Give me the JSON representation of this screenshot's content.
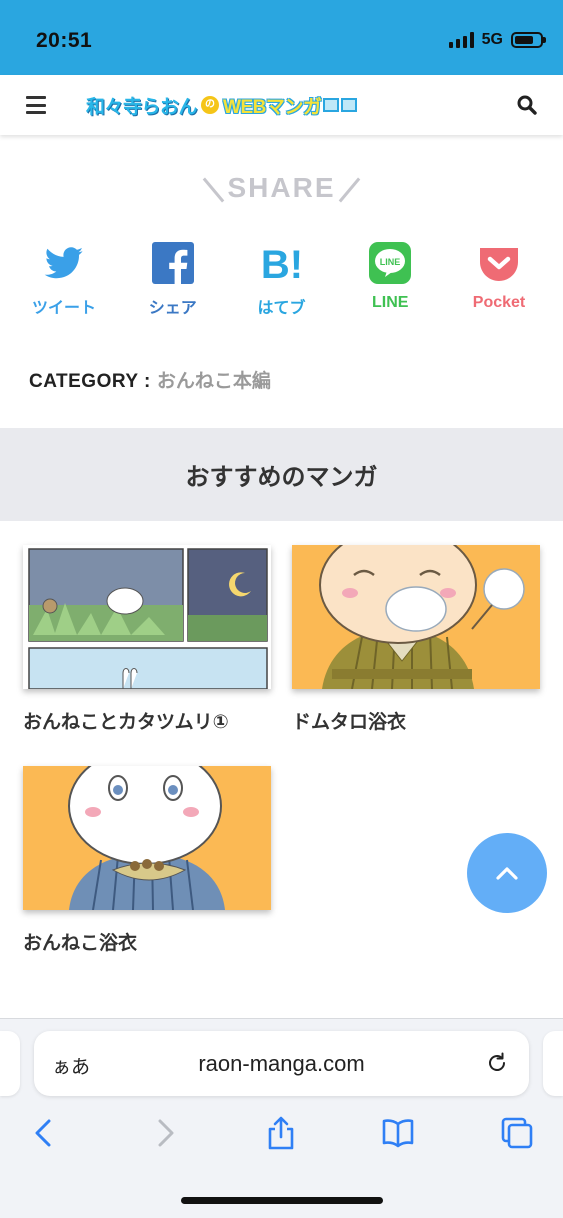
{
  "status_bar": {
    "time": "20:51",
    "network": "5G"
  },
  "header": {
    "logo_part1": "和々寺らおん",
    "logo_no": "の",
    "logo_part2": "WEBマンガ"
  },
  "share": {
    "title": "SHARE",
    "items": [
      {
        "label": "ツイート",
        "icon": "twitter-bird-icon",
        "color": "#3aa0e8"
      },
      {
        "label": "シェア",
        "icon": "facebook-icon",
        "color": "#3b78c4"
      },
      {
        "label": "はてブ",
        "icon": "hatena-bookmark-icon",
        "color": "#2aa6e0"
      },
      {
        "label": "LINE",
        "icon": "line-icon",
        "color": "#3fc152"
      },
      {
        "label": "Pocket",
        "icon": "pocket-icon",
        "color": "#ef6b74"
      }
    ]
  },
  "category": {
    "key": "CATEGORY :",
    "value": "おんねこ本編"
  },
  "recommended": {
    "title": "おすすめのマンガ",
    "items": [
      {
        "title": "おんねことカタツムリ①"
      },
      {
        "title": "ドムタロ浴衣"
      },
      {
        "title": "おんねこ浴衣"
      }
    ]
  },
  "browser": {
    "aa_label": "ぁあ",
    "url": "raon-manga.com"
  },
  "colors": {
    "accent": "#2aa6e0",
    "to_top": "#63aef7",
    "band": "#e9eaee"
  }
}
